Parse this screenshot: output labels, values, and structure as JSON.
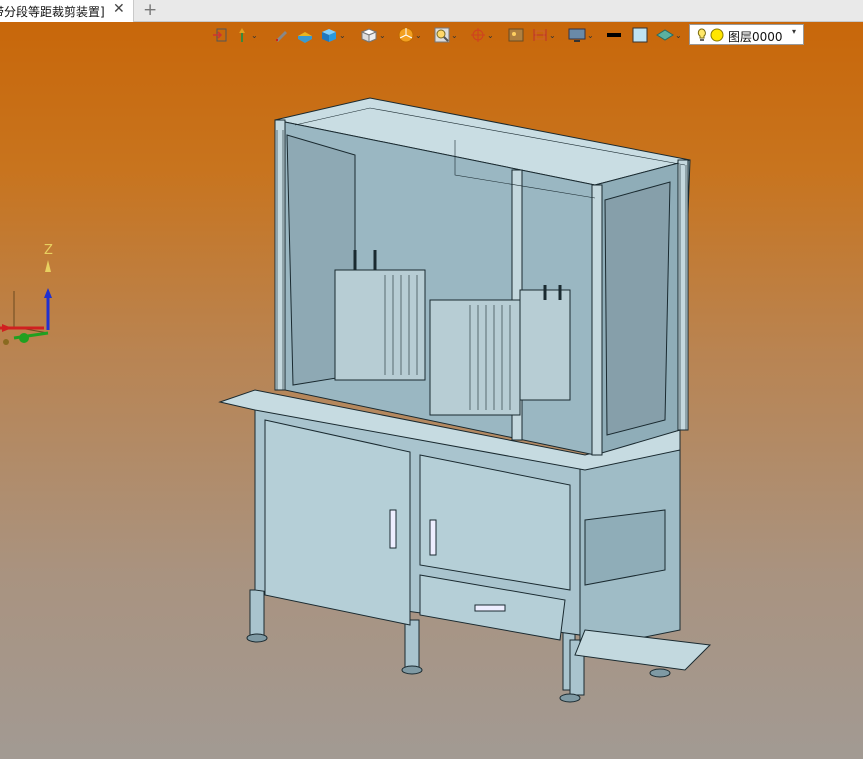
{
  "tab": {
    "title": "带分段等距裁剪装置]",
    "close": "✕",
    "add": "+"
  },
  "toolbar": {
    "layer_label": "图层0000",
    "layer_dropdown": "▾"
  },
  "triad": {
    "z_label": "Z"
  },
  "icons": [
    "view-icon",
    "sketch-icon",
    "pen-icon",
    "fill-icon",
    "box-icon",
    "cube-icon",
    "pie-icon",
    "zoom-icon",
    "snap-icon",
    "render-icon",
    "dimension-icon",
    "monitor-icon",
    "line-color-icon",
    "face-color-icon",
    "style-icon",
    "light-icon",
    "layer-color-icon"
  ],
  "colors": {
    "viewport_top": "#c8670a",
    "viewport_bottom": "#a29a93",
    "model_fill": "#a9c4ce",
    "model_line": "#1a2a30"
  }
}
